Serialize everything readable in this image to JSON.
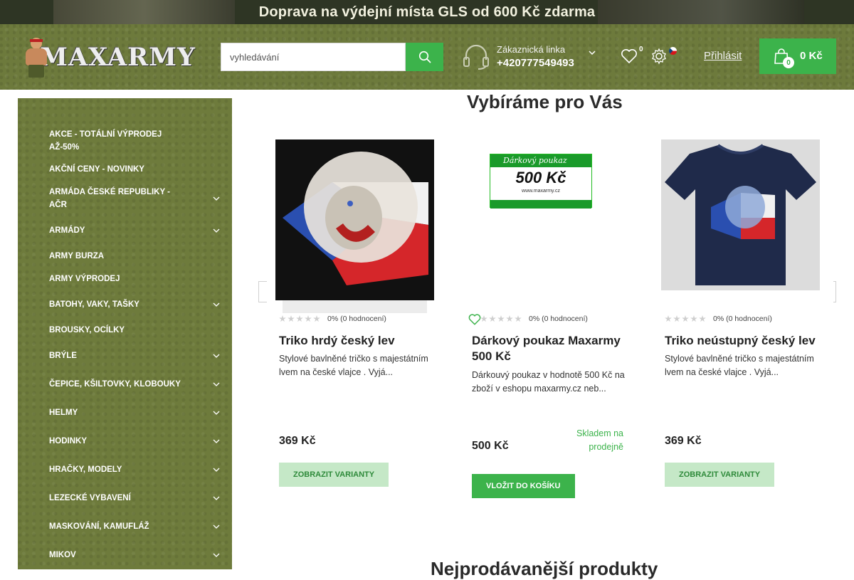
{
  "banner": {
    "text": "Doprava na výdejní místa GLS od 600 Kč zdarma"
  },
  "header": {
    "logo_text": "MAXARMY",
    "search_placeholder": "vyhledávání",
    "hotline_label": "Zákaznická linka",
    "hotline_number": "+420777549493",
    "wishlist_count": "0",
    "login_label": "Přihlásit",
    "cart_count": "0",
    "cart_total": "0 Kč"
  },
  "sidebar": {
    "items": [
      {
        "label": "AKCE - TOTÁLNÍ VÝPRODEJ AŽ-50%",
        "has_children": false
      },
      {
        "label": "AKČNÍ CENY - NOVINKY",
        "has_children": false
      },
      {
        "label": "ARMÁDA ČESKÉ REPUBLIKY - AČR",
        "has_children": true
      },
      {
        "label": "ARMÁDY",
        "has_children": true
      },
      {
        "label": "ARMY BURZA",
        "has_children": false
      },
      {
        "label": "ARMY VÝPRODEJ",
        "has_children": false
      },
      {
        "label": "BATOHY, VAKY, TAŠKY",
        "has_children": true
      },
      {
        "label": "BROUSKY, OCÍLKY",
        "has_children": false
      },
      {
        "label": "BRÝLE",
        "has_children": true
      },
      {
        "label": "ČEPICE, KŠILTOVKY, KLOBOUKY",
        "has_children": true
      },
      {
        "label": "HELMY",
        "has_children": true
      },
      {
        "label": "HODINKY",
        "has_children": true
      },
      {
        "label": "HRAČKY, MODELY",
        "has_children": true
      },
      {
        "label": "LEZECKÉ VYBAVENÍ",
        "has_children": true
      },
      {
        "label": "MASKOVÁNÍ, KAMUFLÁŽ",
        "has_children": true
      },
      {
        "label": "MIKOV",
        "has_children": true
      }
    ]
  },
  "main": {
    "section_title": "Vybíráme pro Vás",
    "next_section_title": "Nejprodávanější produkty",
    "products": [
      {
        "name": "Triko hrdý český lev",
        "rating": "0% (0 hodnocení)",
        "description": "Stylové bavlněné tričko s majestátním lvem na české vlajce . Vyjá...",
        "price": "369 Kč",
        "stock": "",
        "button": "ZOBRAZIT VARIANTY"
      },
      {
        "name": "Dárkový poukaz Maxarmy 500 Kč",
        "rating": "0% (0 hodnocení)",
        "description": "Dárkouvý poukaz v hodnotě 500 Kč na zboží v eshopu maxarmy.cz neb...",
        "price": "500 Kč",
        "stock": "Skladem na prodejně",
        "button": "VLOŽIT DO KOŠÍKU",
        "voucher": {
          "title": "Dárkový poukaz",
          "amount": "500 Kč",
          "url": "www.maxarmy.cz"
        }
      },
      {
        "name": "Triko neústupný český lev",
        "rating": "0% (0 hodnocení)",
        "description": "Stylové bavlněné tričko s majestátním lvem na české vlajce . Vyjá...",
        "price": "369 Kč",
        "stock": "",
        "button": "ZOBRAZIT VARIANTY"
      }
    ]
  },
  "colors": {
    "accent_green": "#3cb34b",
    "olive": "#6d7a3c",
    "stock_green": "#3cb34b"
  }
}
